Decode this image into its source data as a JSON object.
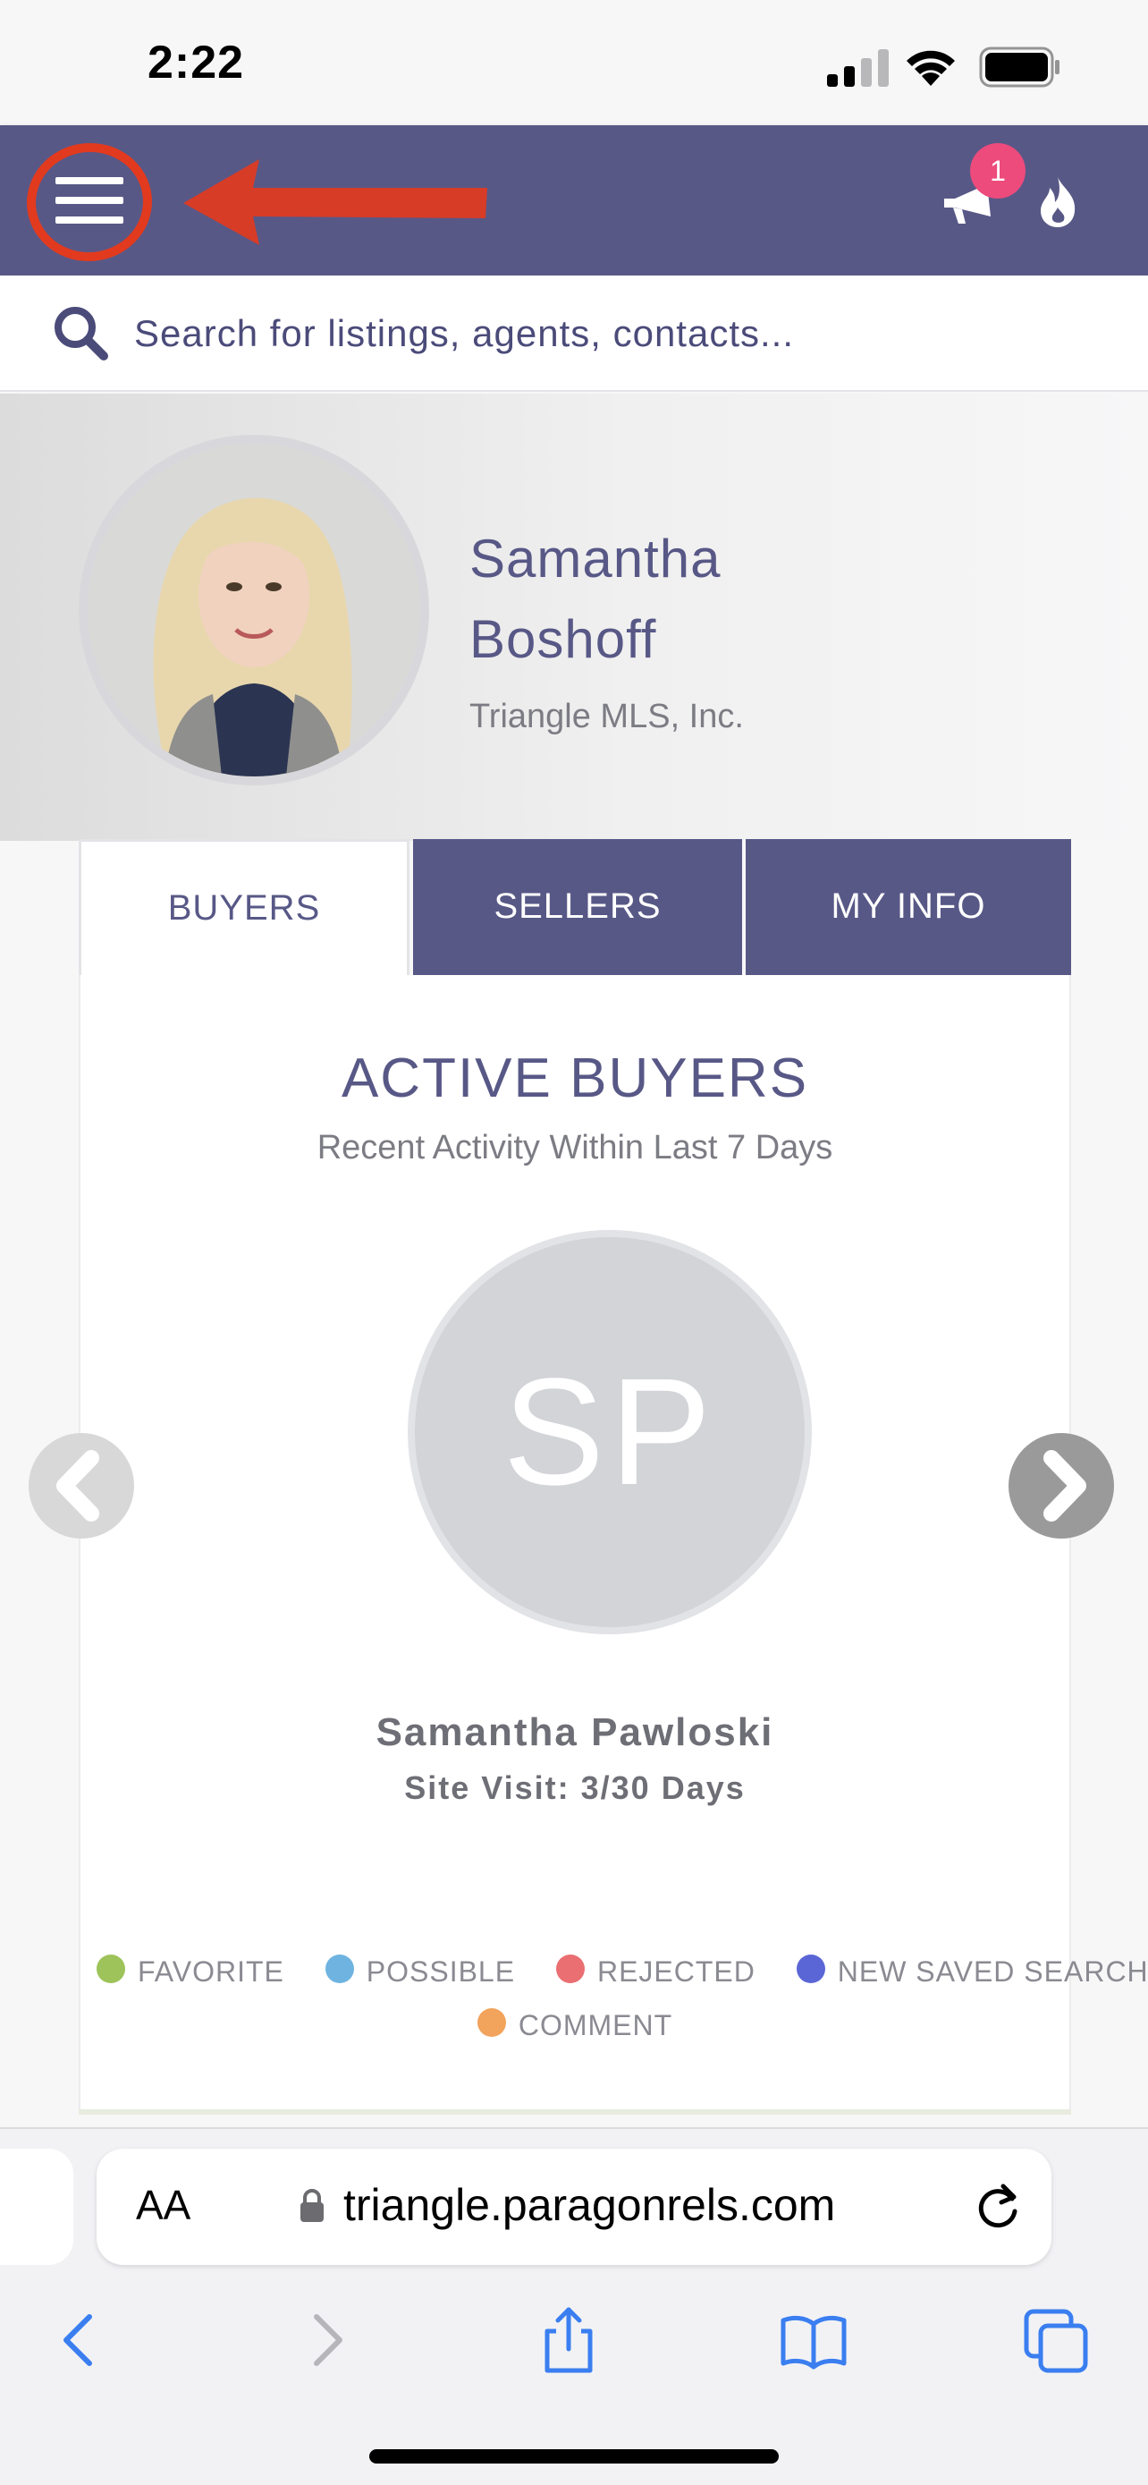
{
  "status_bar": {
    "time": "2:22"
  },
  "header": {
    "menu_icon": "hamburger-menu-icon",
    "notification_count": "1",
    "notification_icon": "megaphone-icon",
    "fire_icon": "flame-icon",
    "colors": {
      "header_bg": "#585887",
      "badge": "#ec4b7c",
      "annotation": "#e23a1e"
    }
  },
  "search": {
    "placeholder": "Search for listings, agents, contacts..."
  },
  "profile": {
    "name": "Samantha Boshoff",
    "company": "Triangle MLS, Inc."
  },
  "tabs": [
    {
      "label": "BUYERS",
      "active": true
    },
    {
      "label": "SELLERS",
      "active": false
    },
    {
      "label": "MY INFO",
      "active": false
    }
  ],
  "buyers_panel": {
    "title": "ACTIVE BUYERS",
    "subtitle": "Recent Activity Within Last 7 Days",
    "buyer": {
      "initials": "SP",
      "name": "Samantha Pawloski",
      "site_visit": "Site Visit: 3/30 Days"
    },
    "legend": [
      {
        "label": "FAVORITE",
        "color": "#9dc35a"
      },
      {
        "label": "POSSIBLE",
        "color": "#6fb4e0"
      },
      {
        "label": "REJECTED",
        "color": "#ea6f72"
      },
      {
        "label": "NEW SAVED SEARCH",
        "color": "#5b66d6"
      },
      {
        "label": "COMMENT",
        "color": "#f2a35c"
      }
    ]
  },
  "browser": {
    "text_size_label": "AA",
    "url": "triangle.paragonrels.com"
  }
}
